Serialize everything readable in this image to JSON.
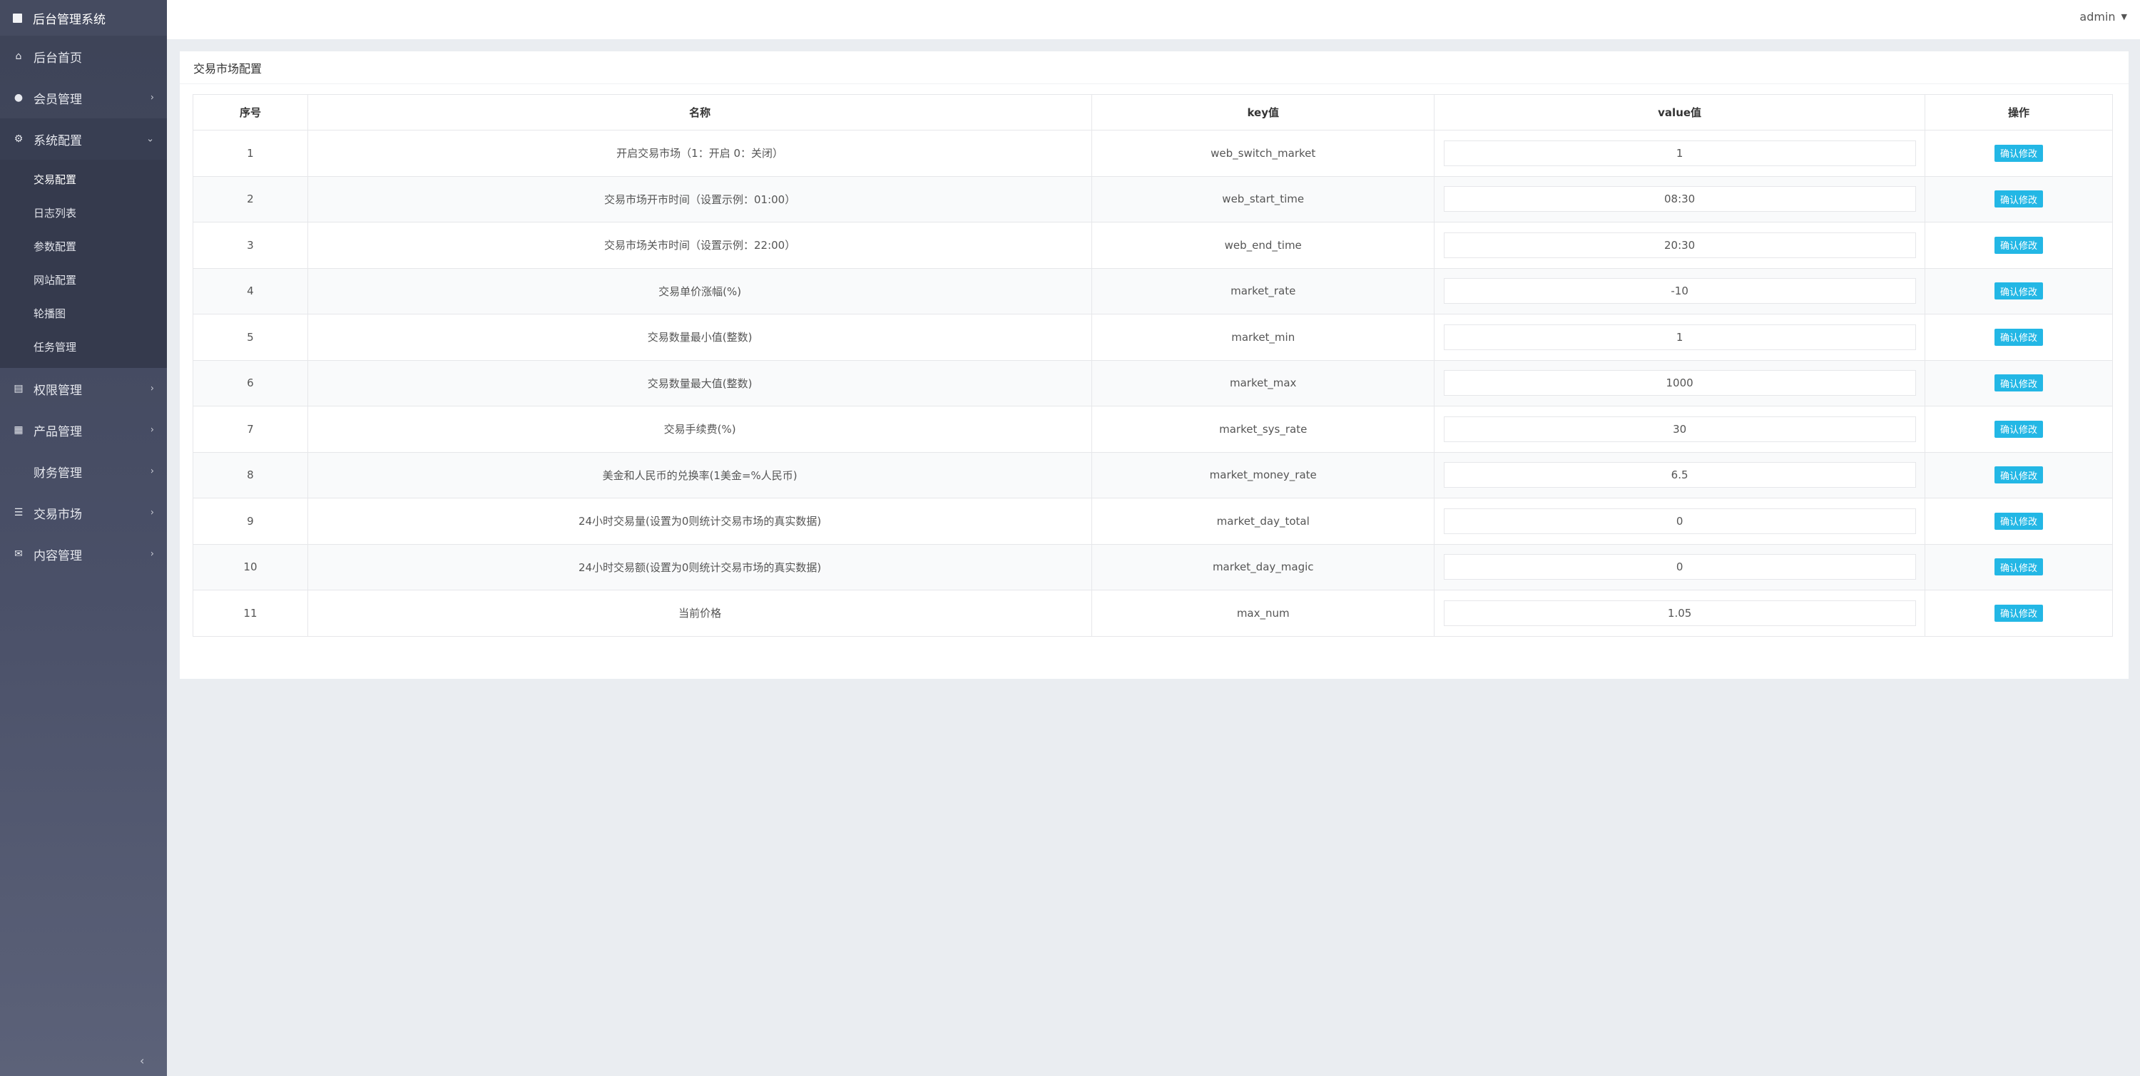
{
  "brand": {
    "title": "后台管理系统"
  },
  "header": {
    "username": "admin"
  },
  "sidebar": {
    "items": [
      {
        "label": "后台首页",
        "icon": "home-icon",
        "open": false
      },
      {
        "label": "会员管理",
        "icon": "user-icon",
        "open": false
      },
      {
        "label": "系统配置",
        "icon": "cogs-icon",
        "open": true
      },
      {
        "label": "权限管理",
        "icon": "id-card-icon",
        "open": false
      },
      {
        "label": "产品管理",
        "icon": "windows-icon",
        "open": false
      },
      {
        "label": "财务管理",
        "icon": "",
        "open": false
      },
      {
        "label": "交易市场",
        "icon": "list-icon",
        "open": false
      },
      {
        "label": "内容管理",
        "icon": "envelope-icon",
        "open": false
      }
    ],
    "submenu": [
      {
        "label": "交易配置",
        "active": true
      },
      {
        "label": "日志列表"
      },
      {
        "label": "参数配置"
      },
      {
        "label": "网站配置"
      },
      {
        "label": "轮播图"
      },
      {
        "label": "任务管理"
      }
    ]
  },
  "panel": {
    "title": "交易市场配置",
    "columns": [
      "序号",
      "名称",
      "key值",
      "value值",
      "操作"
    ],
    "button_label": "确认修改",
    "rows": [
      {
        "no": "1",
        "name": "开启交易市场（1：开启 0：关闭）",
        "key": "web_switch_market",
        "value": "1"
      },
      {
        "no": "2",
        "name": "交易市场开市时间（设置示例：01:00）",
        "key": "web_start_time",
        "value": "08:30"
      },
      {
        "no": "3",
        "name": "交易市场关市时间（设置示例：22:00）",
        "key": "web_end_time",
        "value": "20:30"
      },
      {
        "no": "4",
        "name": "交易单价涨幅(%)",
        "key": "market_rate",
        "value": "-10"
      },
      {
        "no": "5",
        "name": "交易数量最小值(整数)",
        "key": "market_min",
        "value": "1"
      },
      {
        "no": "6",
        "name": "交易数量最大值(整数)",
        "key": "market_max",
        "value": "1000"
      },
      {
        "no": "7",
        "name": "交易手续费(%)",
        "key": "market_sys_rate",
        "value": "30"
      },
      {
        "no": "8",
        "name": "美金和人民币的兑换率(1美金=%人民币)",
        "key": "market_money_rate",
        "value": "6.5"
      },
      {
        "no": "9",
        "name": "24小时交易量(设置为0则统计交易市场的真实数据)",
        "key": "market_day_total",
        "value": "0"
      },
      {
        "no": "10",
        "name": "24小时交易额(设置为0则统计交易市场的真实数据)",
        "key": "market_day_magic",
        "value": "0"
      },
      {
        "no": "11",
        "name": "当前价格",
        "key": "max_num",
        "value": "1.05"
      }
    ]
  },
  "colors": {
    "accent": "#23b7e5",
    "sidebar": "#454b60"
  }
}
